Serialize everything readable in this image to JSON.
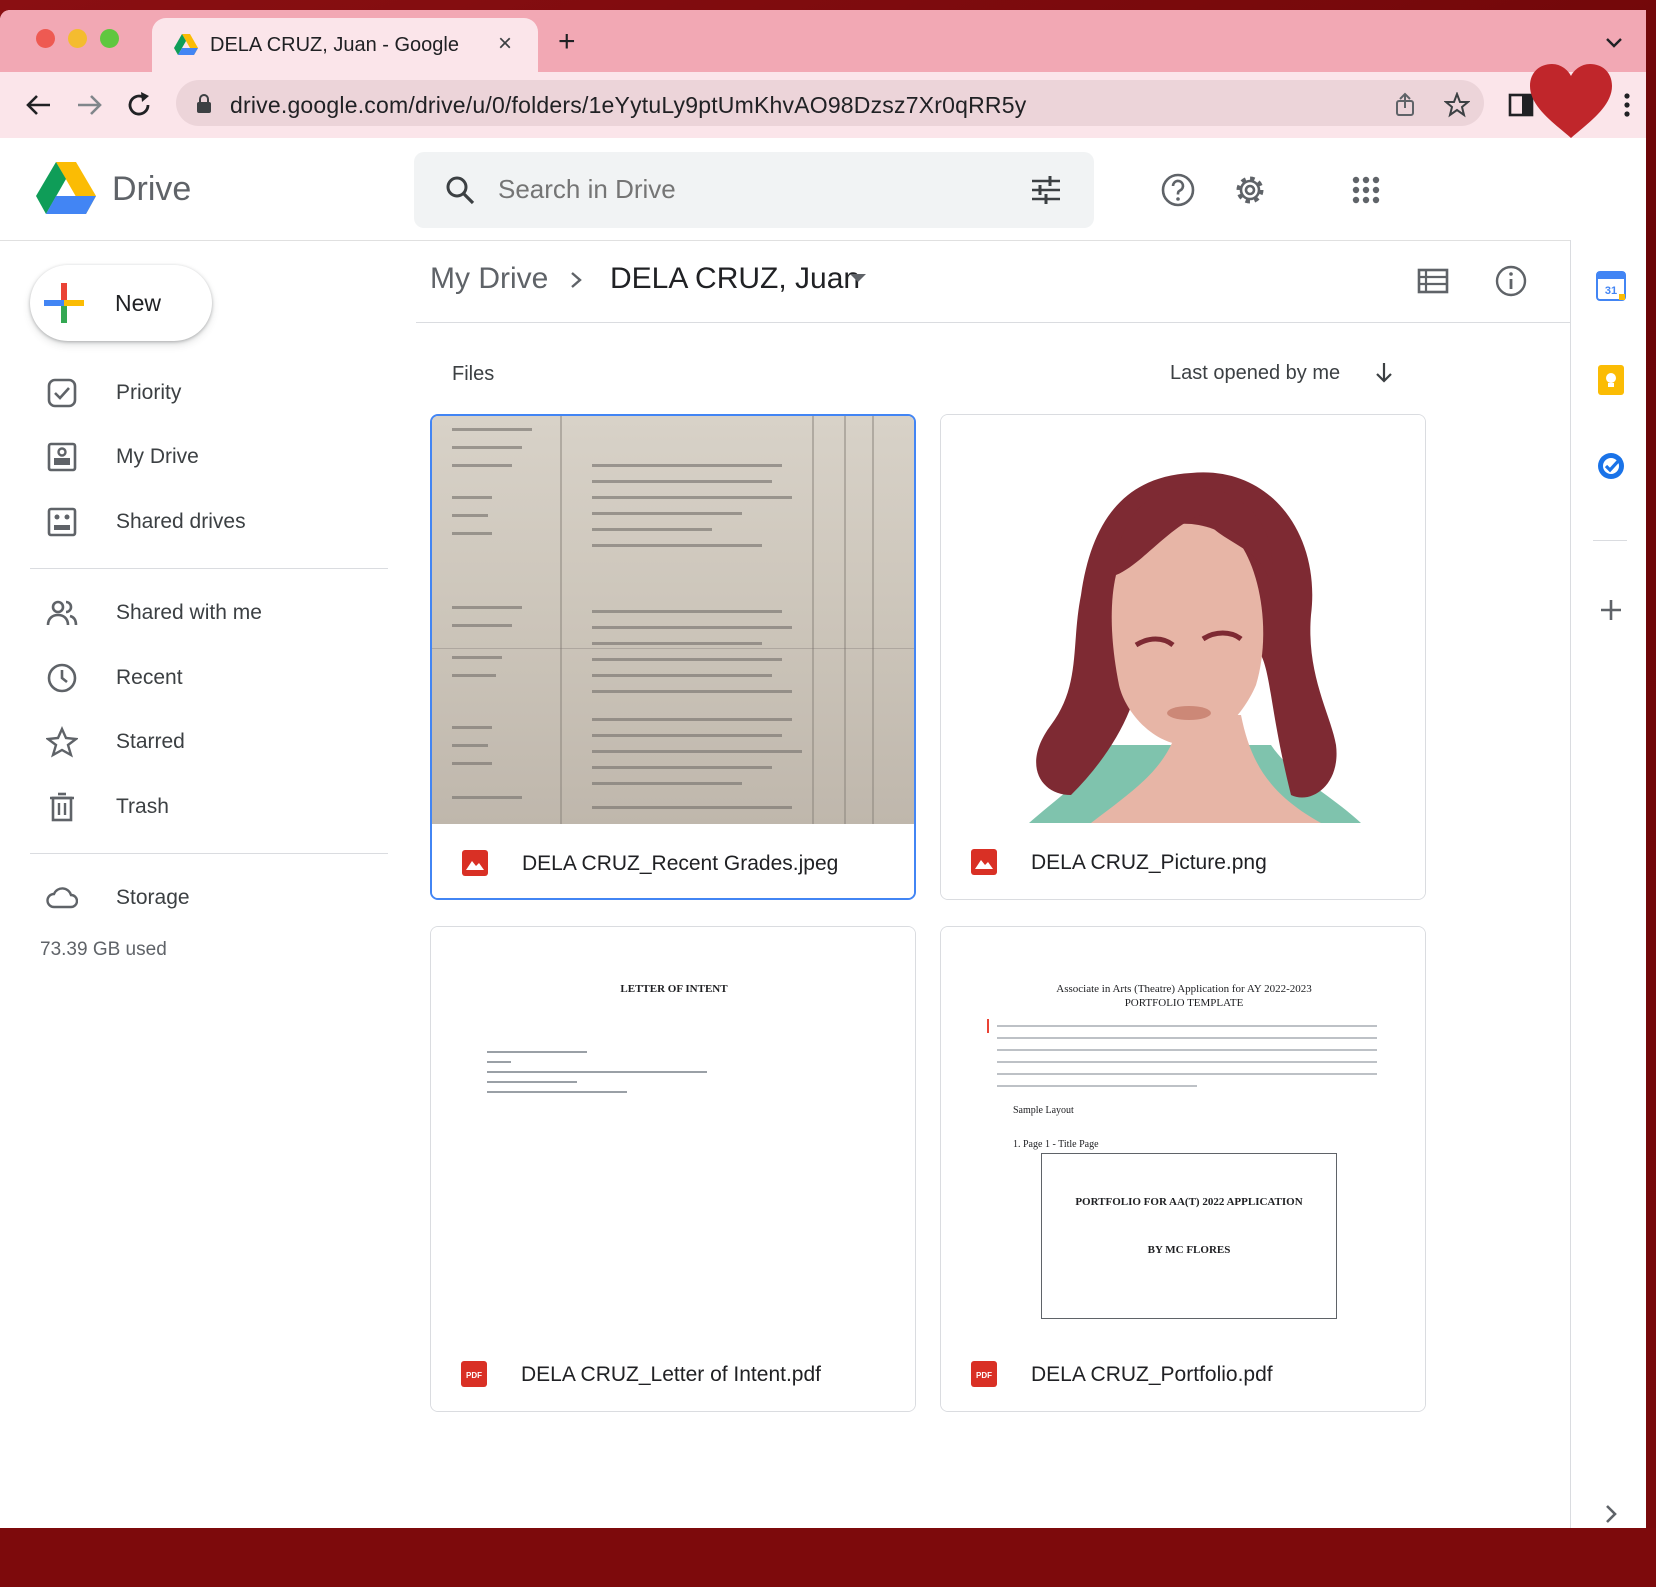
{
  "browser": {
    "tab_title": "DELA CRUZ, Juan - Google Drive",
    "new_tab": "+",
    "close_tab": "×",
    "url": "drive.google.com/drive/u/0/folders/1eYytuLy9ptUmKhvAO98Dzsz7Xr0qRR5y"
  },
  "header": {
    "app_name": "Drive",
    "search_placeholder": "Search in Drive"
  },
  "sidebar": {
    "new_label": "New",
    "items": [
      {
        "label": "Priority",
        "icon": "priority-icon"
      },
      {
        "label": "My Drive",
        "icon": "my-drive-icon"
      },
      {
        "label": "Shared drives",
        "icon": "shared-drives-icon"
      },
      {
        "label": "Shared with me",
        "icon": "shared-with-me-icon"
      },
      {
        "label": "Recent",
        "icon": "clock-icon"
      },
      {
        "label": "Starred",
        "icon": "star-icon"
      },
      {
        "label": "Trash",
        "icon": "trash-icon"
      },
      {
        "label": "Storage",
        "icon": "cloud-icon"
      }
    ],
    "storage_used": "73.39 GB used"
  },
  "breadcrumb": {
    "root": "My Drive",
    "current": "DELA CRUZ, Juan"
  },
  "files_section": {
    "label": "Files",
    "sort_label": "Last opened by me"
  },
  "files": [
    {
      "name": "DELA CRUZ_Recent Grades.jpeg",
      "type": "image"
    },
    {
      "name": "DELA CRUZ_Picture.png",
      "type": "image"
    },
    {
      "name": "DELA CRUZ_Letter of Intent.pdf",
      "type": "pdf"
    },
    {
      "name": "DELA CRUZ_Portfolio.pdf",
      "type": "pdf"
    }
  ],
  "thumbnails": {
    "letter_heading": "LETTER OF INTENT",
    "portfolio_heading_1": "Associate in Arts (Theatre) Application for AY 2022-2023",
    "portfolio_heading_2": "PORTFOLIO TEMPLATE",
    "portfolio_sample": "Sample Layout",
    "portfolio_page": "1.  Page 1 - Title Page",
    "portfolio_box_title": "PORTFOLIO FOR AA(T) 2022 APPLICATION",
    "portfolio_box_by": "BY MC FLORES"
  },
  "right_panel": {
    "calendar_day": "31"
  },
  "colors": {
    "accent_blue": "#4285f4",
    "tab_pink": "#f2a8b4",
    "heart_red": "#c0262b",
    "image_icon_red": "#d93025"
  }
}
